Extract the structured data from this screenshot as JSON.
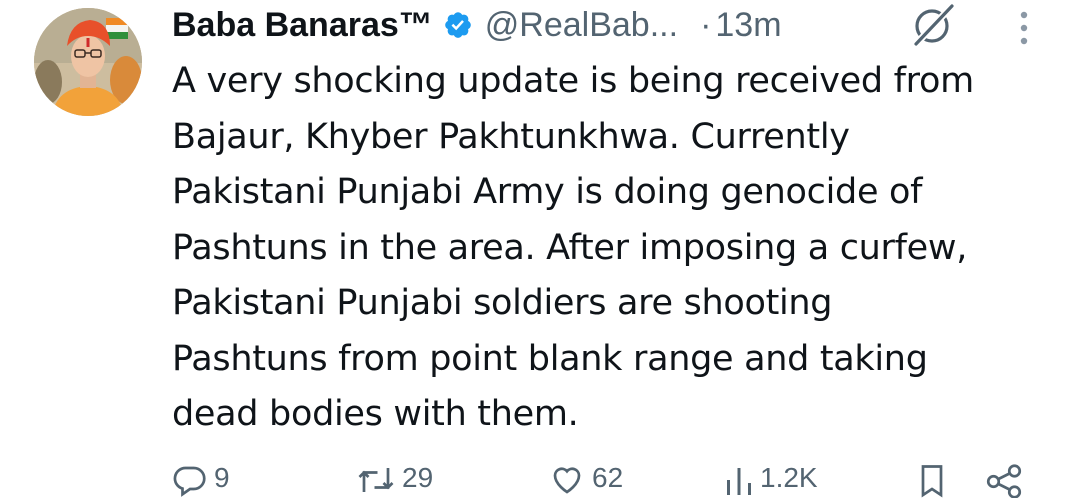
{
  "author": {
    "display_name": "Baba Banaras™",
    "handle": "@RealBab...",
    "separator": "·",
    "time": "13m",
    "verified": true
  },
  "icons": {
    "verified": "verified-badge-icon",
    "grok": "grok-icon",
    "more": "more-vertical-icon",
    "reply": "reply-icon",
    "retweet": "retweet-icon",
    "like": "heart-icon",
    "views": "views-icon",
    "bookmark": "bookmark-icon",
    "share": "share-icon"
  },
  "tweet": {
    "text": "A very shocking update is being received from\nBajaur, Khyber Pakhtunkhwa. Currently\nPakistani Punjabi Army is doing genocide of\nPashtuns in the area. After imposing a curfew,\nPakistani Punjabi soldiers are shooting\nPashtuns from point blank range and taking\ndead bodies with them."
  },
  "actions": {
    "replies": "9",
    "retweets": "29",
    "likes": "62",
    "views": "1.2K"
  },
  "colors": {
    "text": "#0f1419",
    "secondary": "#536471",
    "verified": "#1d9bf0"
  }
}
